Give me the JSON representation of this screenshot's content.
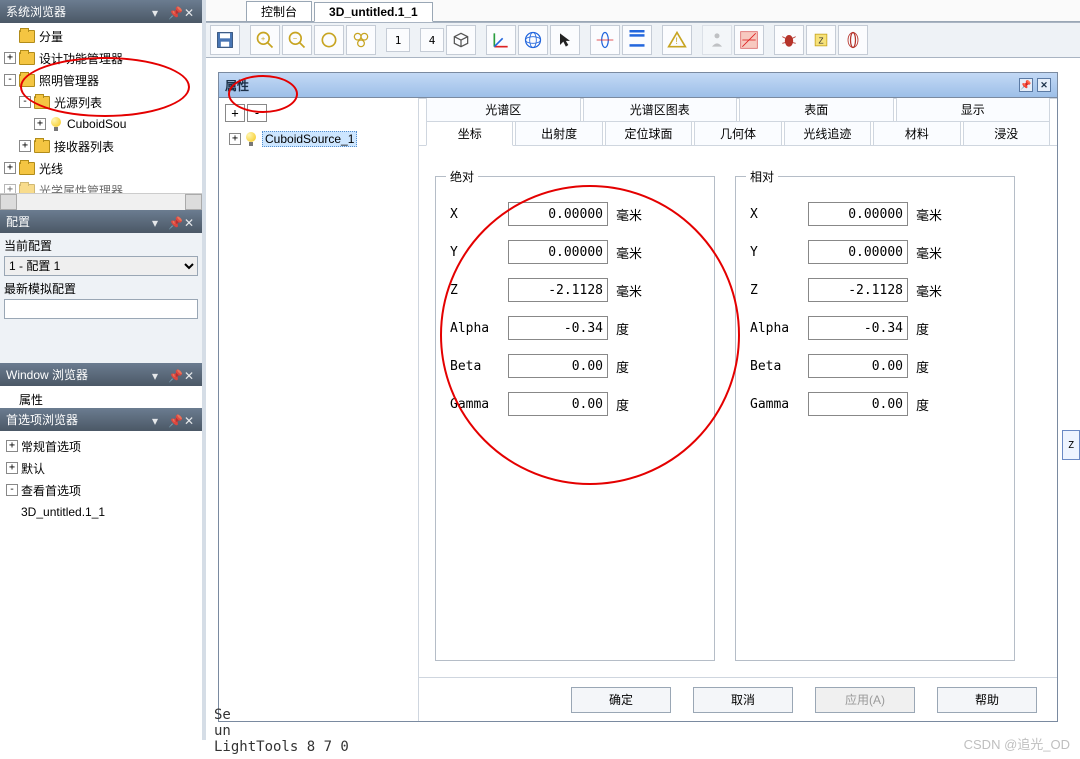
{
  "left": {
    "system_browser": {
      "title": "系统浏览器",
      "items": {
        "component": "分量",
        "design_mgr": "设计功能管理器",
        "light_mgr": "照明管理器",
        "source_list": "光源列表",
        "cuboid_src": "CuboidSou",
        "receiver_list": "接收器列表",
        "ray": "光线",
        "opt_prop_mgr": "光学属性管理器"
      }
    },
    "config_panel": {
      "title": "配置",
      "current_label": "当前配置",
      "select_value": "1 - 配置 1",
      "latest_label": "最新模拟配置",
      "latest_value": ""
    },
    "window_browser": {
      "title": "Window 浏览器",
      "item_props": "属性"
    },
    "pref_browser": {
      "title": "首选项浏览器",
      "general": "常规首选项",
      "default": "默认",
      "view": "查看首选项",
      "doc": "3D_untitled.1_1"
    }
  },
  "doc_tabs": {
    "console": "控制台",
    "active": "3D_untitled.1_1"
  },
  "toolbar": {
    "num1": "1",
    "num4": "4"
  },
  "prop": {
    "title": "属性",
    "tree_item": "CuboidSource_1",
    "tabs_top": {
      "spectral_region": "光谱区",
      "spectral_chart": "光谱区图表",
      "surface": "表面",
      "display": "显示"
    },
    "tabs_bottom": {
      "coord": "坐标",
      "emittance": "出射度",
      "sphere": "定位球面",
      "geom": "几何体",
      "raytrace": "光线追迹",
      "material": "材料",
      "immerse": "浸没"
    },
    "abs": {
      "legend": "绝对",
      "x_label": "X",
      "x_val": "0.00000",
      "x_unit": "毫米",
      "y_label": "Y",
      "y_val": "0.00000",
      "y_unit": "毫米",
      "z_label": "Z",
      "z_val": "-2.1128",
      "z_unit": "毫米",
      "a_label": "Alpha",
      "a_val": "-0.34",
      "a_unit": "度",
      "b_label": "Beta",
      "b_val": "0.00",
      "b_unit": "度",
      "g_label": "Gamma",
      "g_val": "0.00",
      "g_unit": "度"
    },
    "rel": {
      "legend": "相对",
      "x_label": "X",
      "x_val": "0.00000",
      "x_unit": "毫米",
      "y_label": "Y",
      "y_val": "0.00000",
      "y_unit": "毫米",
      "z_label": "Z",
      "z_val": "-2.1128",
      "z_unit": "毫米",
      "a_label": "Alpha",
      "a_val": "-0.34",
      "a_unit": "度",
      "b_label": "Beta",
      "b_val": "0.00",
      "b_unit": "度",
      "g_label": "Gamma",
      "g_val": "0.00",
      "g_unit": "度"
    },
    "buttons": {
      "ok": "确定",
      "cancel": "取消",
      "apply": "应用(A)",
      "help": "帮助"
    }
  },
  "footer": {
    "l1": "Se",
    "l2": "un",
    "l3": "LightTools 8 7 0"
  },
  "watermark": "CSDN @追光_OD",
  "side_marker": "Z"
}
